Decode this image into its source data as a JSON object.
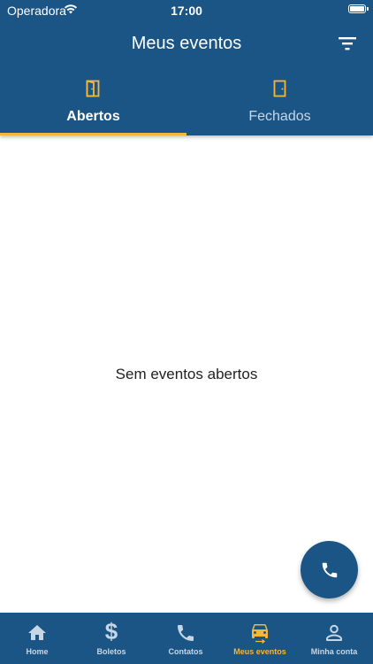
{
  "status_bar": {
    "carrier": "Operadora",
    "time": "17:00"
  },
  "header": {
    "title": "Meus eventos",
    "filter_icon": "filter-list-icon"
  },
  "tabs": [
    {
      "label": "Abertos",
      "icon": "door-open-icon",
      "active": true
    },
    {
      "label": "Fechados",
      "icon": "door-closed-icon",
      "active": false
    }
  ],
  "main": {
    "empty_message": "Sem eventos abertos"
  },
  "fab": {
    "icon": "phone-icon"
  },
  "bottom_nav": {
    "items": [
      {
        "label": "Home",
        "icon": "home-icon",
        "active": false
      },
      {
        "label": "Boletos",
        "icon": "dollar-icon",
        "active": false
      },
      {
        "label": "Contatos",
        "icon": "phone-icon",
        "active": false
      },
      {
        "label": "Meus eventos",
        "icon": "car-icon",
        "active": true
      },
      {
        "label": "Minha conta",
        "icon": "person-icon",
        "active": false
      }
    ]
  },
  "colors": {
    "primary": "#1b5585",
    "accent": "#f3b73b",
    "inactive": "#c7d6e6"
  }
}
